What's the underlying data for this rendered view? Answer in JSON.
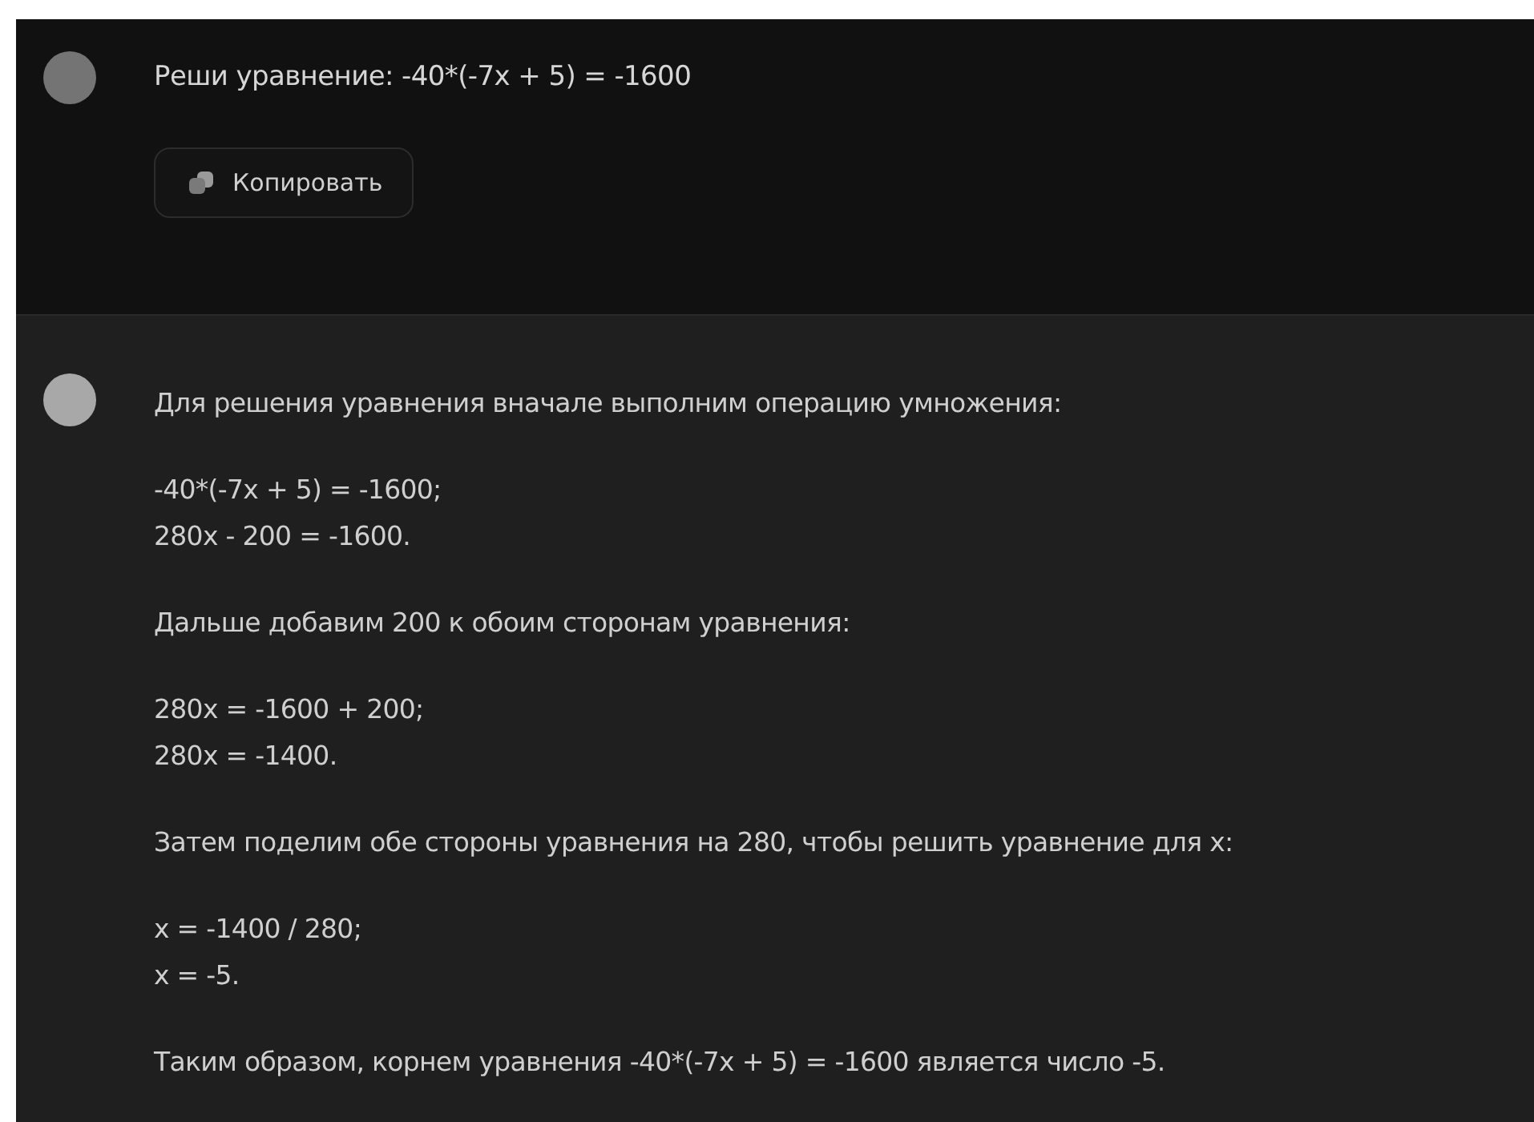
{
  "messages": [
    {
      "kind": "user",
      "text": "Реши уравнение: -40*(-7x + 5) = -1600",
      "button": "Копировать"
    },
    {
      "kind": "assistant",
      "paragraphs": [
        [
          "Для решения уравнения вначале выполним операцию умножения:"
        ],
        [
          "-40*(-7x + 5) = -1600;",
          "280x - 200 = -1600."
        ],
        [
          "Дальше добавим 200 к обоим сторонам уравнения:"
        ],
        [
          "280x = -1600 + 200;",
          "280x = -1400."
        ],
        [
          "Затем поделим обе стороны уравнения на 280, чтобы решить уравнение для x:"
        ],
        [
          "x = -1400 / 280;",
          "x = -5."
        ],
        [
          "Таким образом, корнем уравнения -40*(-7x + 5) = -1600 является число -5."
        ]
      ]
    }
  ]
}
